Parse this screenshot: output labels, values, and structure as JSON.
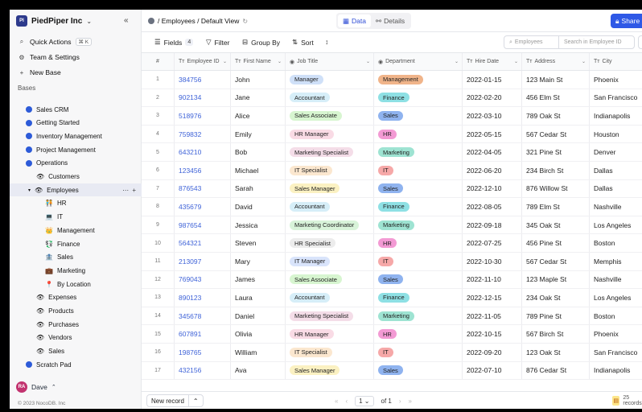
{
  "workspace": {
    "name": "PiedPiper Inc",
    "logo": "PI"
  },
  "sidebar": {
    "quick_actions": "Quick Actions",
    "shortcut": "⌘ K",
    "team_settings": "Team & Settings",
    "new_base": "New Base",
    "bases_heading": "Bases",
    "bases": [
      "Sales CRM",
      "Getting Started",
      "Inventory Management",
      "Project Management",
      "Operations"
    ],
    "operations_children": [
      "Customers",
      "Employees"
    ],
    "employee_views": [
      {
        "label": "HR",
        "icon": "🧑‍🤝‍🧑"
      },
      {
        "label": "IT",
        "icon": "💻"
      },
      {
        "label": "Management",
        "icon": "👑"
      },
      {
        "label": "Finance",
        "icon": "💱"
      },
      {
        "label": "Sales",
        "icon": "🏦"
      },
      {
        "label": "Marketing",
        "icon": "💼"
      },
      {
        "label": "By Location",
        "icon": "📍"
      }
    ],
    "tables_after": [
      "Expenses",
      "Products",
      "Purchases",
      "Vendors",
      "Sales"
    ],
    "scratch_pad": "Scratch Pad",
    "user": {
      "initials": "RA",
      "name": "Dave"
    },
    "copyright": "© 2023 NocoDB. Inc"
  },
  "topbar": {
    "breadcrumb": "/ Employees / Default View",
    "tab_data": "Data",
    "tab_details": "Details",
    "share": "Share"
  },
  "toolbar": {
    "fields": "Fields",
    "fields_count": "4",
    "filter": "Filter",
    "group_by": "Group By",
    "sort": "Sort",
    "search_field": "Employees",
    "search_placeholder": "Search in Employee ID"
  },
  "columns": [
    "#",
    "Employee ID",
    "First Name",
    "Job Title",
    "Department",
    "Hire Date",
    "Address",
    "City"
  ],
  "colors": {
    "accent": "#2f59e6",
    "departments": {
      "Management": "#f0b48a",
      "Finance": "#8ee0e4",
      "Sales": "#8fb3ef",
      "HR": "#f39ad4",
      "Marketing": "#9ee3d2",
      "IT": "#f6a8a8"
    },
    "jobs": {
      "Manager": "#cfe0f8",
      "Accountant": "#d6eef8",
      "Sales Associate": "#d7f5d0",
      "HR Manager": "#f9dbe5",
      "Marketing Specialist": "#f4dde8",
      "IT Specialist": "#fbe7cf",
      "Sales Manager": "#fbf1c2",
      "Marketing Coordinator": "#d8f3d9",
      "HR Specialist": "#ececec",
      "IT Manager": "#d9e4fb"
    }
  },
  "rows": [
    {
      "n": "1",
      "id": "384756",
      "first": "John",
      "job": "Manager",
      "dept": "Management",
      "hire": "2022-01-15",
      "addr": "123 Main St",
      "city": "Phoenix"
    },
    {
      "n": "2",
      "id": "902134",
      "first": "Jane",
      "job": "Accountant",
      "dept": "Finance",
      "hire": "2022-02-20",
      "addr": "456 Elm St",
      "city": "San Francisco"
    },
    {
      "n": "3",
      "id": "518976",
      "first": "Alice",
      "job": "Sales Associate",
      "dept": "Sales",
      "hire": "2022-03-10",
      "addr": "789 Oak St",
      "city": "Indianapolis"
    },
    {
      "n": "4",
      "id": "759832",
      "first": "Emily",
      "job": "HR Manager",
      "dept": "HR",
      "hire": "2022-05-15",
      "addr": "567 Cedar St",
      "city": "Houston"
    },
    {
      "n": "5",
      "id": "643210",
      "first": "Bob",
      "job": "Marketing Specialist",
      "dept": "Marketing",
      "hire": "2022-04-05",
      "addr": "321 Pine St",
      "city": "Denver"
    },
    {
      "n": "6",
      "id": "123456",
      "first": "Michael",
      "job": "IT Specialist",
      "dept": "IT",
      "hire": "2022-06-20",
      "addr": "234 Birch St",
      "city": "Dallas"
    },
    {
      "n": "7",
      "id": "876543",
      "first": "Sarah",
      "job": "Sales Manager",
      "dept": "Sales",
      "hire": "2022-12-10",
      "addr": "876 Willow St",
      "city": "Dallas"
    },
    {
      "n": "8",
      "id": "435679",
      "first": "David",
      "job": "Accountant",
      "dept": "Finance",
      "hire": "2022-08-05",
      "addr": "789 Elm St",
      "city": "Nashville"
    },
    {
      "n": "9",
      "id": "987654",
      "first": "Jessica",
      "job": "Marketing Coordinator",
      "dept": "Marketing",
      "hire": "2022-09-18",
      "addr": "345 Oak St",
      "city": "Los Angeles"
    },
    {
      "n": "10",
      "id": "564321",
      "first": "Steven",
      "job": "HR Specialist",
      "dept": "HR",
      "hire": "2022-07-25",
      "addr": "456 Pine St",
      "city": "Boston"
    },
    {
      "n": "11",
      "id": "213097",
      "first": "Mary",
      "job": "IT Manager",
      "dept": "IT",
      "hire": "2022-10-30",
      "addr": "567 Cedar St",
      "city": "Memphis"
    },
    {
      "n": "12",
      "id": "769043",
      "first": "James",
      "job": "Sales Associate",
      "dept": "Sales",
      "hire": "2022-11-10",
      "addr": "123 Maple St",
      "city": "Nashville"
    },
    {
      "n": "13",
      "id": "890123",
      "first": "Laura",
      "job": "Accountant",
      "dept": "Finance",
      "hire": "2022-12-15",
      "addr": "234 Oak St",
      "city": "Los Angeles"
    },
    {
      "n": "14",
      "id": "345678",
      "first": "Daniel",
      "job": "Marketing Specialist",
      "dept": "Marketing",
      "hire": "2022-11-05",
      "addr": "789 Pine St",
      "city": "Boston"
    },
    {
      "n": "15",
      "id": "607891",
      "first": "Olivia",
      "job": "HR Manager",
      "dept": "HR",
      "hire": "2022-10-15",
      "addr": "567 Birch St",
      "city": "Phoenix"
    },
    {
      "n": "16",
      "id": "198765",
      "first": "William",
      "job": "IT Specialist",
      "dept": "IT",
      "hire": "2022-09-20",
      "addr": "123 Oak St",
      "city": "San Francisco"
    },
    {
      "n": "17",
      "id": "432156",
      "first": "Ava",
      "job": "Sales Manager",
      "dept": "Sales",
      "hire": "2022-07-10",
      "addr": "876 Cedar St",
      "city": "Indianapolis"
    }
  ],
  "footer": {
    "new_record": "New record",
    "page": "1",
    "of": "of 1",
    "records": "25 records"
  }
}
